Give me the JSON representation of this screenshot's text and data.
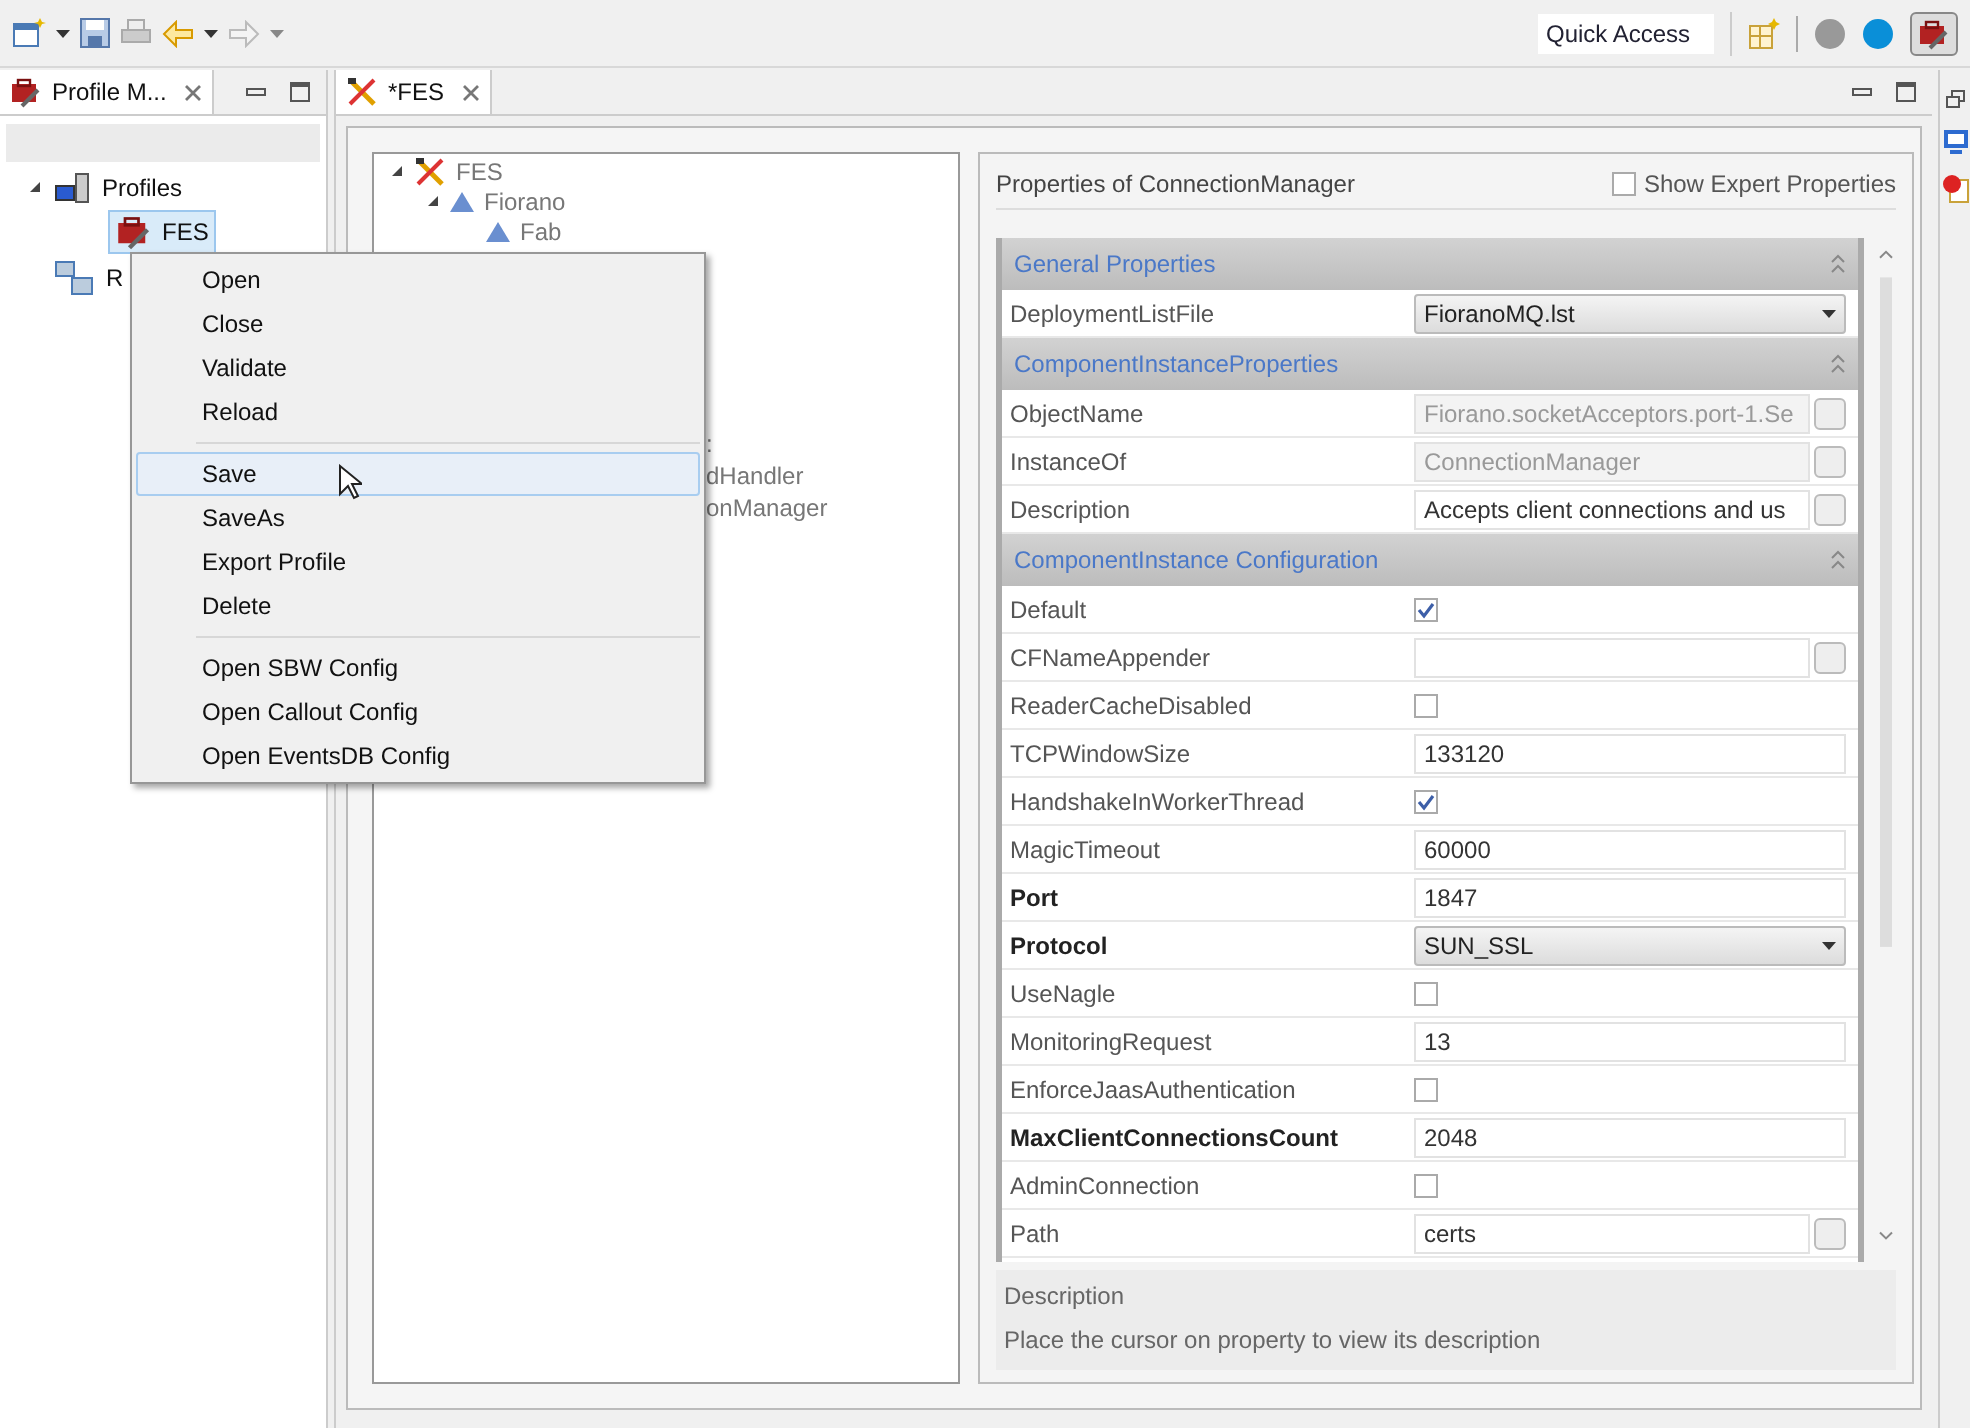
{
  "toolbar": {
    "quick_access": {
      "placeholder": "Quick Access"
    }
  },
  "profile_view": {
    "tab": {
      "label": "Profile M...",
      "selected": true
    },
    "tree": [
      {
        "label": "Profiles",
        "expanded": true,
        "selected": false,
        "children": [
          {
            "label": "FES",
            "selected": true
          }
        ]
      },
      {
        "label": "R",
        "selected": false
      }
    ]
  },
  "editor": {
    "tab": {
      "label": "*FES",
      "selected": true
    },
    "tree": [
      {
        "label": "FES",
        "expanded": true,
        "children": [
          {
            "label": "Fiorano",
            "expanded": true,
            "children": [
              {
                "label": "Fab"
              }
            ]
          }
        ]
      }
    ],
    "tree_cut_labels": [
      ":",
      "dHandler",
      "onManager"
    ],
    "properties": {
      "title": "Properties of ConnectionManager",
      "show_expert": {
        "label": "Show Expert Properties",
        "checked": false
      },
      "sections": [
        {
          "title": "General Properties",
          "rows": [
            {
              "kind": "dropdown",
              "label": "DeploymentListFile",
              "value": "FioranoMQ.lst",
              "bold": false
            }
          ]
        },
        {
          "title": "ComponentInstanceProperties",
          "rows": [
            {
              "kind": "text",
              "label": "ObjectName",
              "value": "Fiorano.socketAcceptors.port-1.Se",
              "ellipsis": true,
              "disabled": true,
              "bold": false
            },
            {
              "kind": "text",
              "label": "InstanceOf",
              "value": "ConnectionManager",
              "ellipsis": true,
              "disabled": true,
              "bold": false
            },
            {
              "kind": "text",
              "label": "Description",
              "value": "Accepts client connections and us",
              "ellipsis": true,
              "disabled": false,
              "bold": false
            }
          ]
        },
        {
          "title": "ComponentInstance Configuration",
          "rows": [
            {
              "kind": "checkbox",
              "label": "Default",
              "checked": true,
              "bold": false
            },
            {
              "kind": "text",
              "label": "CFNameAppender",
              "ellipsis": true,
              "disabled": false,
              "bold": false
            },
            {
              "kind": "checkbox",
              "label": "ReaderCacheDisabled",
              "checked": false,
              "bold": false
            },
            {
              "kind": "text",
              "label": "TCPWindowSize",
              "value": "133120",
              "ellipsis": false,
              "disabled": false,
              "bold": false
            },
            {
              "kind": "checkbox",
              "label": "HandshakeInWorkerThread",
              "checked": true,
              "bold": false
            },
            {
              "kind": "text",
              "label": "MagicTimeout",
              "value": "60000",
              "ellipsis": false,
              "disabled": false,
              "bold": false
            },
            {
              "kind": "text",
              "label": "Port",
              "value": "1847",
              "ellipsis": false,
              "disabled": false,
              "bold": true
            },
            {
              "kind": "dropdown",
              "label": "Protocol",
              "value": "SUN_SSL",
              "bold": true
            },
            {
              "kind": "checkbox",
              "label": "UseNagle",
              "checked": false,
              "bold": false
            },
            {
              "kind": "text",
              "label": "MonitoringRequest",
              "value": "13",
              "ellipsis": false,
              "disabled": false,
              "bold": false
            },
            {
              "kind": "checkbox",
              "label": "EnforceJaasAuthentication",
              "checked": false,
              "bold": false
            },
            {
              "kind": "text",
              "label": "MaxClientConnectionsCount",
              "value": "2048",
              "ellipsis": false,
              "disabled": false,
              "bold": true
            },
            {
              "kind": "checkbox",
              "label": "AdminConnection",
              "checked": false,
              "bold": false
            },
            {
              "kind": "text",
              "label": "Path",
              "value": "certs",
              "ellipsis": true,
              "disabled": false,
              "bold": false
            }
          ]
        }
      ],
      "description": {
        "title": "Description",
        "text": "Place the cursor on property to view its description"
      }
    }
  },
  "context_menu": {
    "groups": [
      [
        {
          "label": "Open",
          "selected": false
        },
        {
          "label": "Close",
          "selected": false
        },
        {
          "label": "Validate",
          "selected": false
        },
        {
          "label": "Reload",
          "selected": false
        }
      ],
      [
        {
          "label": "Save",
          "selected": true
        },
        {
          "label": "SaveAs",
          "selected": false
        },
        {
          "label": "Export Profile",
          "selected": false
        },
        {
          "label": "Delete",
          "selected": false
        }
      ],
      [
        {
          "label": "Open SBW Config",
          "selected": false
        },
        {
          "label": "Open Callout Config",
          "selected": false
        },
        {
          "label": "Open EventsDB Config",
          "selected": false
        }
      ]
    ]
  }
}
